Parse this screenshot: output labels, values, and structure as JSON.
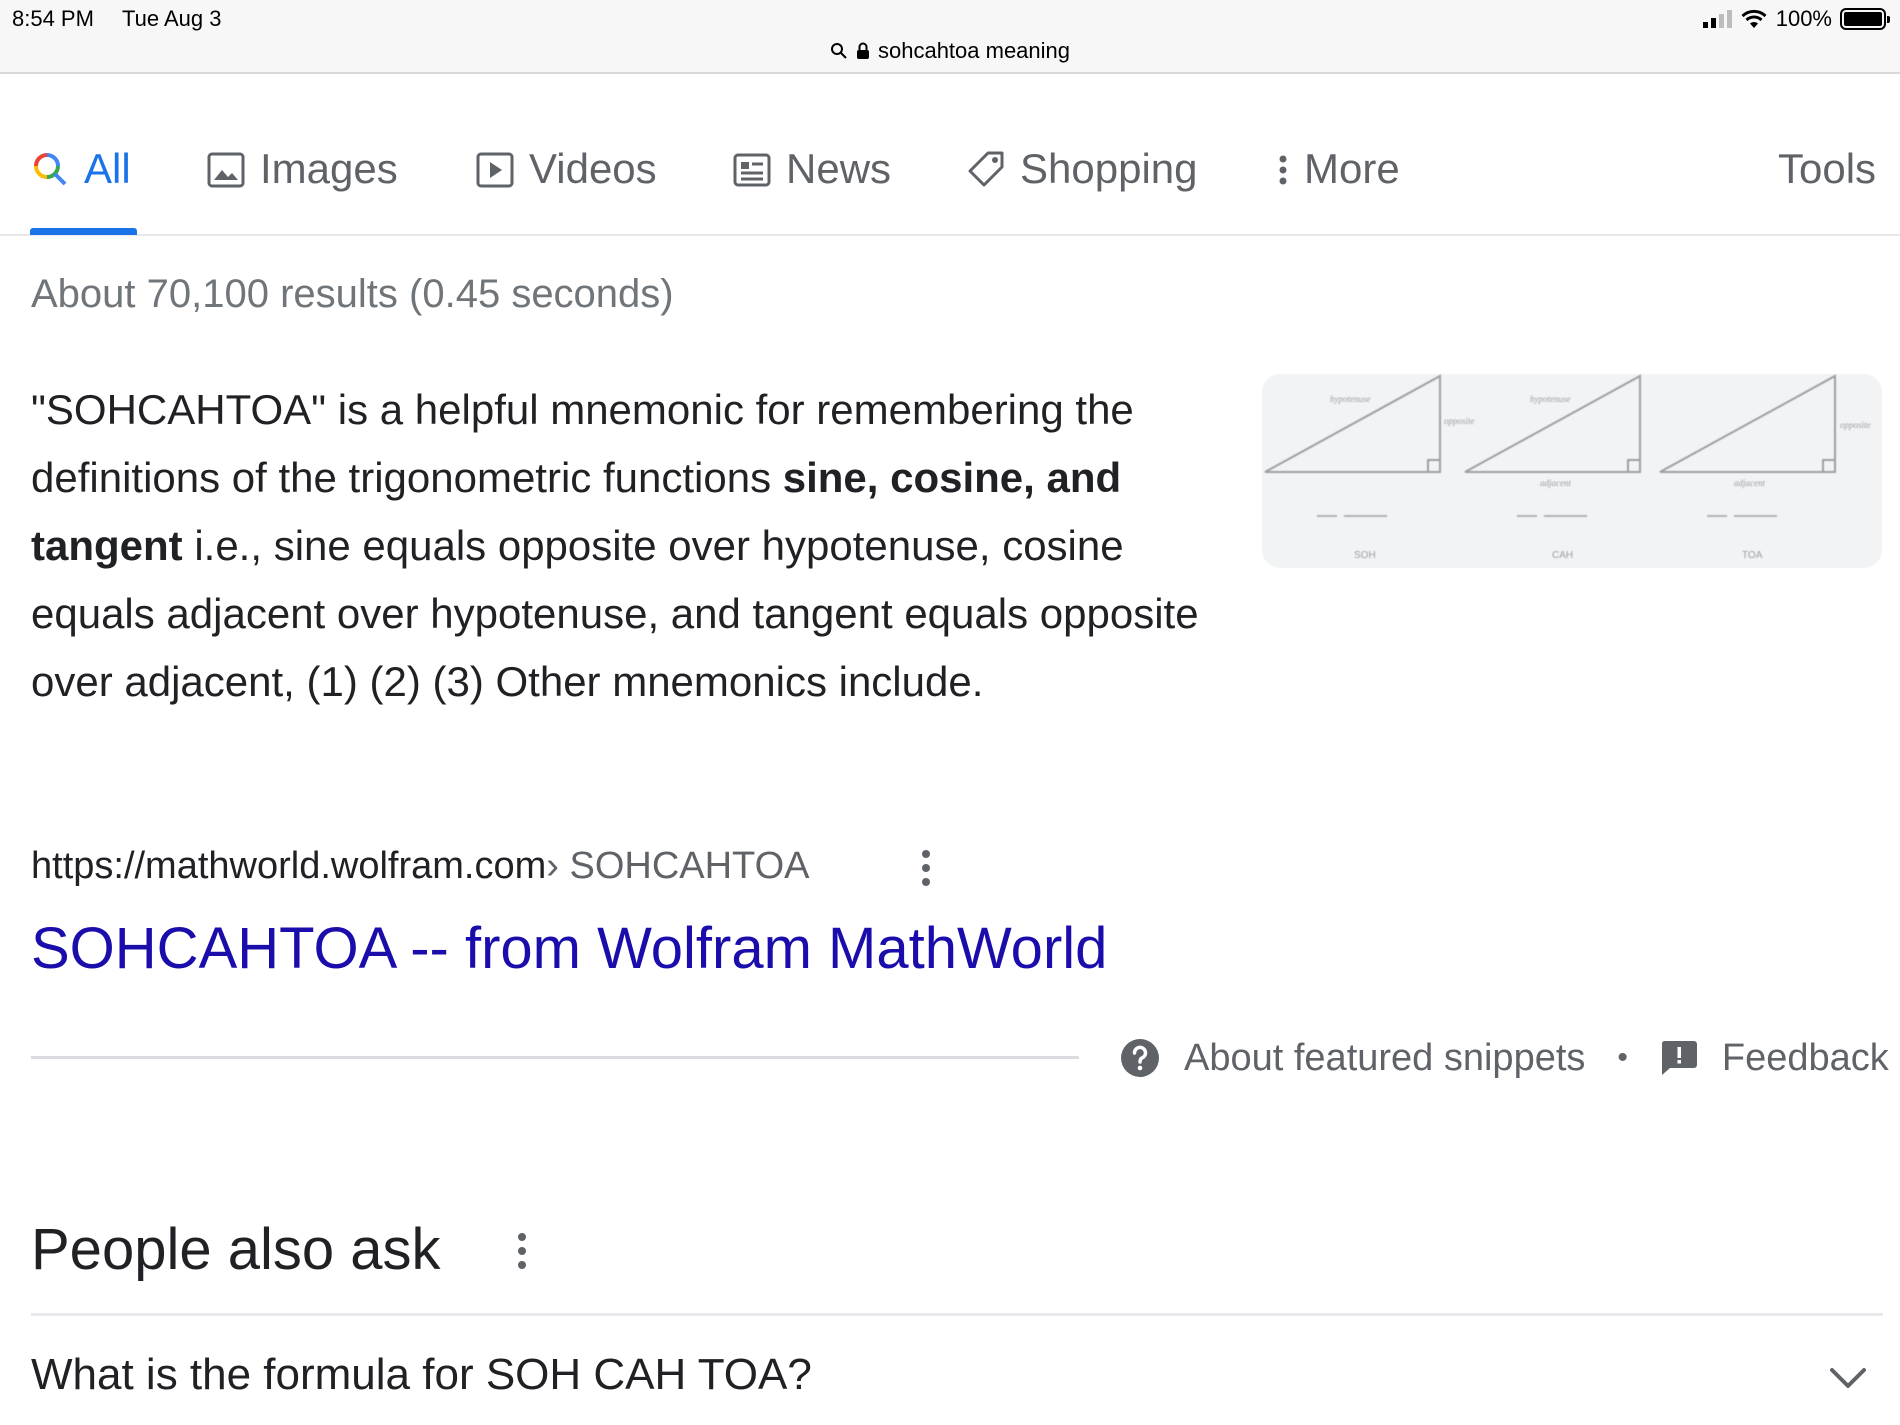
{
  "status": {
    "time": "8:54 PM",
    "date": "Tue Aug 3",
    "battery": "100%",
    "url_text": "sohcahtoa meaning"
  },
  "tabs": [
    {
      "label": "All",
      "icon": "search-icon",
      "active": true
    },
    {
      "label": "Images",
      "icon": "image-icon"
    },
    {
      "label": "Videos",
      "icon": "play-icon"
    },
    {
      "label": "News",
      "icon": "newspaper-icon"
    },
    {
      "label": "Shopping",
      "icon": "tag-icon"
    },
    {
      "label": "More",
      "icon": "more-vertical-icon"
    }
  ],
  "tools_label": "Tools",
  "results_stats": "About 70,100 results (0.45 seconds)",
  "snippet": {
    "text_1": "\"SOHCAHTOA\" is a helpful mnemonic for remembering the definitions of the trigonometric functions ",
    "bold": "sine, cosine, and tangent",
    "text_2": " i.e., sine equals opposite over hypotenuse, cosine equals adjacent over hypotenuse, and tangent equals opposite over adjacent, (1) (2) (3) Other mnemonics include."
  },
  "snippet_image": {
    "icon": "trig-triangles-image",
    "captions": [
      "SOH",
      "CAH",
      "TOA"
    ],
    "side_labels": [
      "hypotenuse",
      "opposite",
      "hypotenuse",
      "adjacent",
      "opposite",
      "adjacent"
    ]
  },
  "source": {
    "url": "https://mathworld.wolfram.com",
    "breadcrumb": " › SOHCAHTOA"
  },
  "result_title": "SOHCAHTOA -- from Wolfram MathWorld",
  "footer": {
    "about": "About featured snippets",
    "separator": "•",
    "feedback": "Feedback"
  },
  "paa": {
    "title": "People also ask",
    "questions": [
      "What is the formula for SOH CAH TOA?"
    ]
  },
  "colors": {
    "link": "#1a0dab",
    "accent": "#1a73e8",
    "muted": "#5f6368"
  }
}
